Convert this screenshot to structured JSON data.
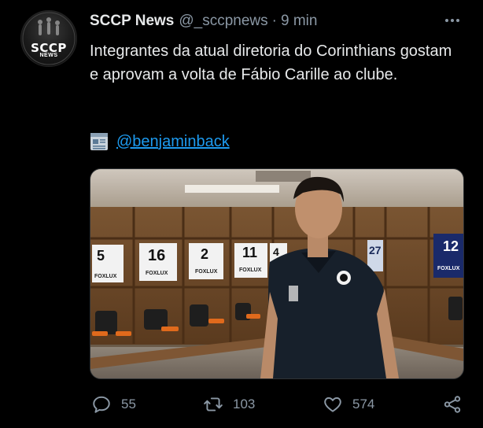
{
  "tweet": {
    "author_name": "SCCP News",
    "handle": "@_sccpnews",
    "separator": "·",
    "time": "9 min",
    "text": "Integrantes da atual diretoria do Corinthians gostam e aprovam a volta de Fábio Carille ao clube.",
    "source_icon": "newspaper-icon",
    "mention": "@benjaminback",
    "avatar": {
      "text": "SCCP",
      "subtext": "NEWS"
    },
    "media": {
      "description_icon": "photo",
      "jersey_numbers": [
        "5",
        "16",
        "2",
        "11",
        "4",
        "27",
        "12"
      ],
      "sponsor": "FOXLUX"
    },
    "actions": {
      "reply_count": "55",
      "retweet_count": "103",
      "like_count": "574"
    }
  },
  "colors": {
    "background": "#000000",
    "text_primary": "#e7e9ea",
    "text_secondary": "#8b98a5",
    "link": "#1d9bf0"
  }
}
